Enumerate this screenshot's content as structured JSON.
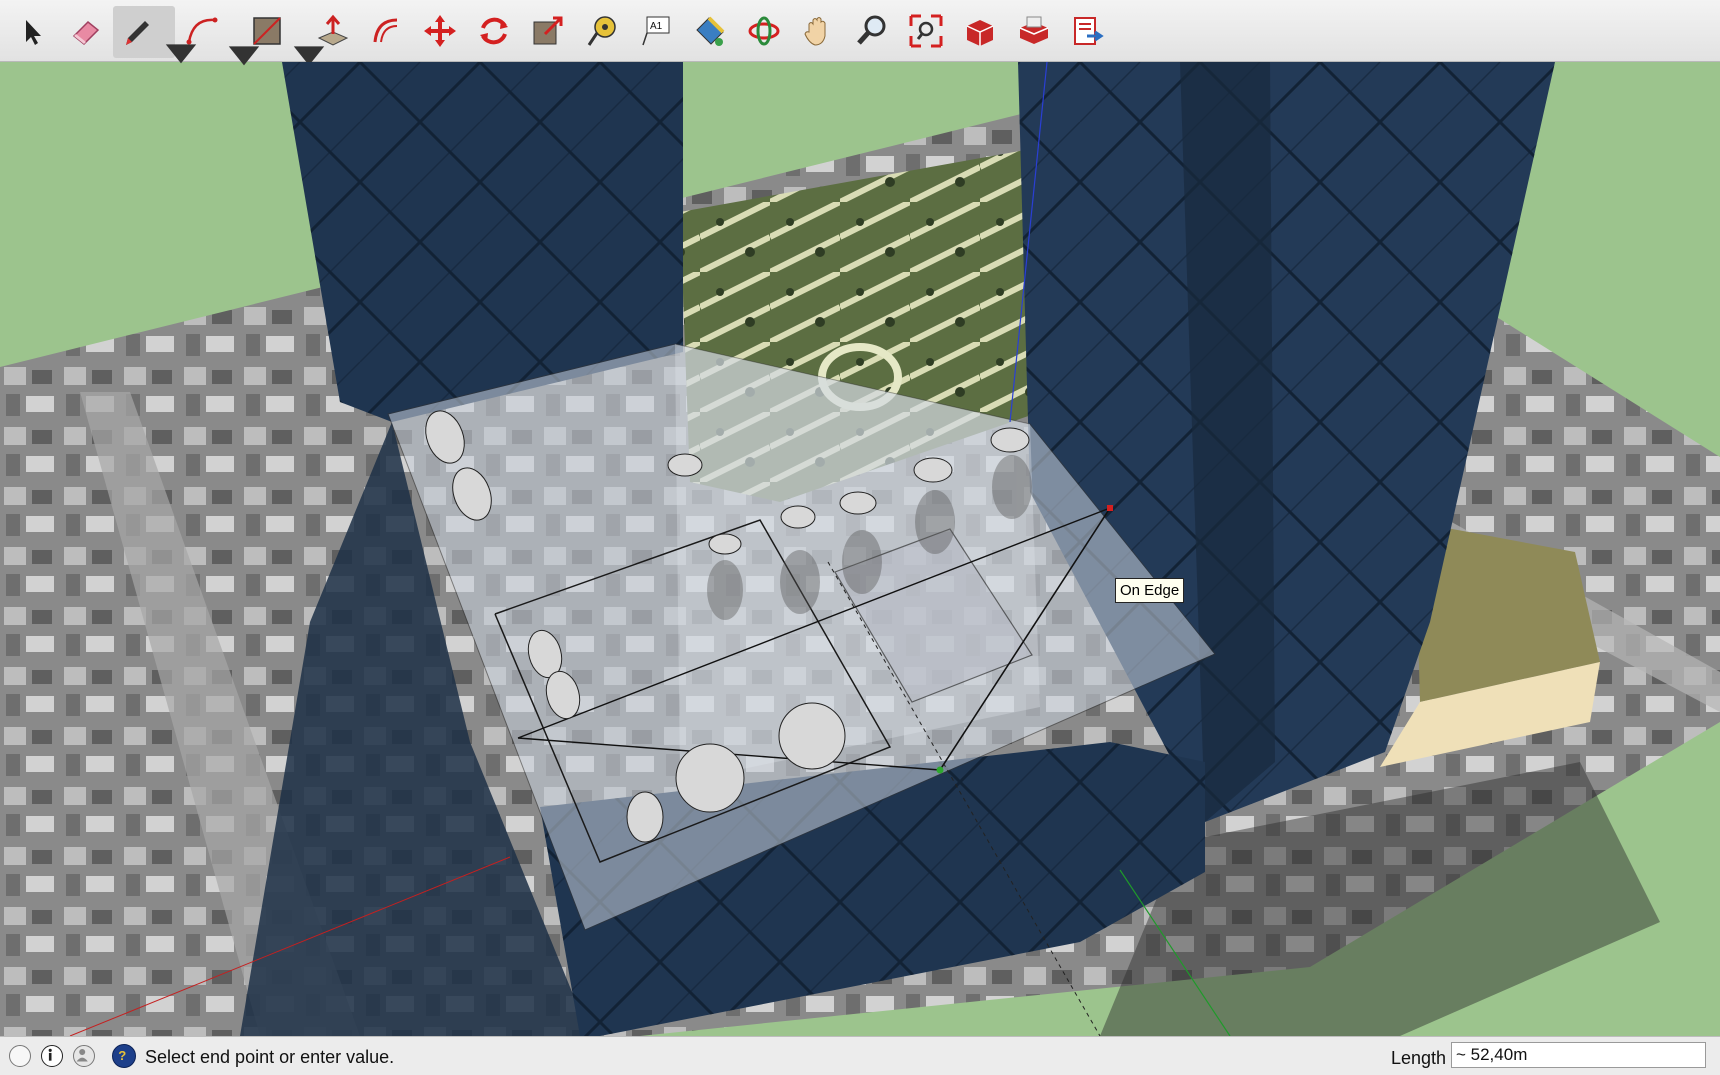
{
  "toolbar": {
    "tools": [
      {
        "name": "select-tool",
        "icon": "arrow-pointer-icon"
      },
      {
        "name": "eraser-tool",
        "icon": "eraser-icon"
      },
      {
        "name": "line-tool",
        "icon": "pencil-icon",
        "active": true,
        "has_dropdown": true
      },
      {
        "name": "arc-tool",
        "icon": "arc-icon",
        "has_dropdown": true
      },
      {
        "name": "rectangle-tool",
        "icon": "rectangle-icon",
        "has_dropdown": true
      },
      {
        "name": "push-pull-tool",
        "icon": "push-pull-icon"
      },
      {
        "name": "offset-tool",
        "icon": "offset-icon"
      },
      {
        "name": "move-tool",
        "icon": "move-arrows-icon"
      },
      {
        "name": "rotate-tool",
        "icon": "rotate-icon"
      },
      {
        "name": "scale-tool",
        "icon": "scale-icon"
      },
      {
        "name": "tape-measure-tool",
        "icon": "tape-measure-icon"
      },
      {
        "name": "text-tool",
        "icon": "text-label-icon",
        "label": "A1"
      },
      {
        "name": "paint-bucket-tool",
        "icon": "paint-bucket-icon"
      },
      {
        "name": "orbit-tool",
        "icon": "orbit-icon"
      },
      {
        "name": "pan-tool",
        "icon": "hand-icon"
      },
      {
        "name": "zoom-tool",
        "icon": "magnifier-icon"
      },
      {
        "name": "zoom-extents-tool",
        "icon": "zoom-extents-icon"
      },
      {
        "name": "warehouse-tool",
        "icon": "3d-warehouse-icon"
      },
      {
        "name": "extension-warehouse-tool",
        "icon": "extension-warehouse-icon"
      },
      {
        "name": "send-to-layout-tool",
        "icon": "send-to-layout-icon"
      }
    ]
  },
  "viewport": {
    "inference_tooltip": "On Edge",
    "colors": {
      "sky_ground": "#9cc48d",
      "glass": "#1f3550",
      "glass_light": "#2d4a6b",
      "roof_overlay": "#c9d1dc"
    }
  },
  "statusbar": {
    "icons": [
      "geo-location-icon",
      "info-icon",
      "user-credit-icon",
      "help-icon"
    ],
    "message": "Select end point or enter value.",
    "length_label": "Length",
    "length_value": "~ 52,40m"
  }
}
